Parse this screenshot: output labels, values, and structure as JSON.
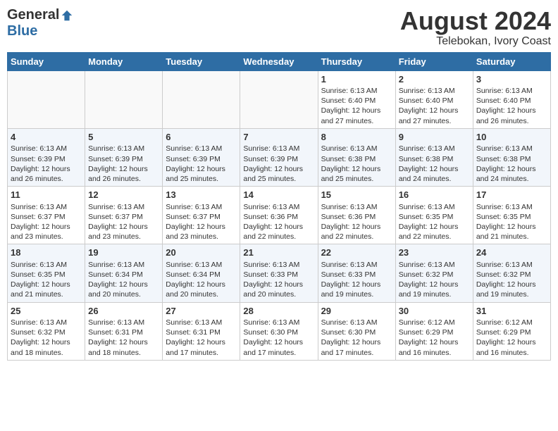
{
  "header": {
    "logo_general": "General",
    "logo_blue": "Blue",
    "month_title": "August 2024",
    "subtitle": "Telebokan, Ivory Coast"
  },
  "days_of_week": [
    "Sunday",
    "Monday",
    "Tuesday",
    "Wednesday",
    "Thursday",
    "Friday",
    "Saturday"
  ],
  "weeks": [
    [
      {
        "day": "",
        "content": ""
      },
      {
        "day": "",
        "content": ""
      },
      {
        "day": "",
        "content": ""
      },
      {
        "day": "",
        "content": ""
      },
      {
        "day": "1",
        "content": "Sunrise: 6:13 AM\nSunset: 6:40 PM\nDaylight: 12 hours\nand 27 minutes."
      },
      {
        "day": "2",
        "content": "Sunrise: 6:13 AM\nSunset: 6:40 PM\nDaylight: 12 hours\nand 27 minutes."
      },
      {
        "day": "3",
        "content": "Sunrise: 6:13 AM\nSunset: 6:40 PM\nDaylight: 12 hours\nand 26 minutes."
      }
    ],
    [
      {
        "day": "4",
        "content": "Sunrise: 6:13 AM\nSunset: 6:39 PM\nDaylight: 12 hours\nand 26 minutes."
      },
      {
        "day": "5",
        "content": "Sunrise: 6:13 AM\nSunset: 6:39 PM\nDaylight: 12 hours\nand 26 minutes."
      },
      {
        "day": "6",
        "content": "Sunrise: 6:13 AM\nSunset: 6:39 PM\nDaylight: 12 hours\nand 25 minutes."
      },
      {
        "day": "7",
        "content": "Sunrise: 6:13 AM\nSunset: 6:39 PM\nDaylight: 12 hours\nand 25 minutes."
      },
      {
        "day": "8",
        "content": "Sunrise: 6:13 AM\nSunset: 6:38 PM\nDaylight: 12 hours\nand 25 minutes."
      },
      {
        "day": "9",
        "content": "Sunrise: 6:13 AM\nSunset: 6:38 PM\nDaylight: 12 hours\nand 24 minutes."
      },
      {
        "day": "10",
        "content": "Sunrise: 6:13 AM\nSunset: 6:38 PM\nDaylight: 12 hours\nand 24 minutes."
      }
    ],
    [
      {
        "day": "11",
        "content": "Sunrise: 6:13 AM\nSunset: 6:37 PM\nDaylight: 12 hours\nand 23 minutes."
      },
      {
        "day": "12",
        "content": "Sunrise: 6:13 AM\nSunset: 6:37 PM\nDaylight: 12 hours\nand 23 minutes."
      },
      {
        "day": "13",
        "content": "Sunrise: 6:13 AM\nSunset: 6:37 PM\nDaylight: 12 hours\nand 23 minutes."
      },
      {
        "day": "14",
        "content": "Sunrise: 6:13 AM\nSunset: 6:36 PM\nDaylight: 12 hours\nand 22 minutes."
      },
      {
        "day": "15",
        "content": "Sunrise: 6:13 AM\nSunset: 6:36 PM\nDaylight: 12 hours\nand 22 minutes."
      },
      {
        "day": "16",
        "content": "Sunrise: 6:13 AM\nSunset: 6:35 PM\nDaylight: 12 hours\nand 22 minutes."
      },
      {
        "day": "17",
        "content": "Sunrise: 6:13 AM\nSunset: 6:35 PM\nDaylight: 12 hours\nand 21 minutes."
      }
    ],
    [
      {
        "day": "18",
        "content": "Sunrise: 6:13 AM\nSunset: 6:35 PM\nDaylight: 12 hours\nand 21 minutes."
      },
      {
        "day": "19",
        "content": "Sunrise: 6:13 AM\nSunset: 6:34 PM\nDaylight: 12 hours\nand 20 minutes."
      },
      {
        "day": "20",
        "content": "Sunrise: 6:13 AM\nSunset: 6:34 PM\nDaylight: 12 hours\nand 20 minutes."
      },
      {
        "day": "21",
        "content": "Sunrise: 6:13 AM\nSunset: 6:33 PM\nDaylight: 12 hours\nand 20 minutes."
      },
      {
        "day": "22",
        "content": "Sunrise: 6:13 AM\nSunset: 6:33 PM\nDaylight: 12 hours\nand 19 minutes."
      },
      {
        "day": "23",
        "content": "Sunrise: 6:13 AM\nSunset: 6:32 PM\nDaylight: 12 hours\nand 19 minutes."
      },
      {
        "day": "24",
        "content": "Sunrise: 6:13 AM\nSunset: 6:32 PM\nDaylight: 12 hours\nand 19 minutes."
      }
    ],
    [
      {
        "day": "25",
        "content": "Sunrise: 6:13 AM\nSunset: 6:32 PM\nDaylight: 12 hours\nand 18 minutes."
      },
      {
        "day": "26",
        "content": "Sunrise: 6:13 AM\nSunset: 6:31 PM\nDaylight: 12 hours\nand 18 minutes."
      },
      {
        "day": "27",
        "content": "Sunrise: 6:13 AM\nSunset: 6:31 PM\nDaylight: 12 hours\nand 17 minutes."
      },
      {
        "day": "28",
        "content": "Sunrise: 6:13 AM\nSunset: 6:30 PM\nDaylight: 12 hours\nand 17 minutes."
      },
      {
        "day": "29",
        "content": "Sunrise: 6:13 AM\nSunset: 6:30 PM\nDaylight: 12 hours\nand 17 minutes."
      },
      {
        "day": "30",
        "content": "Sunrise: 6:12 AM\nSunset: 6:29 PM\nDaylight: 12 hours\nand 16 minutes."
      },
      {
        "day": "31",
        "content": "Sunrise: 6:12 AM\nSunset: 6:29 PM\nDaylight: 12 hours\nand 16 minutes."
      }
    ]
  ]
}
